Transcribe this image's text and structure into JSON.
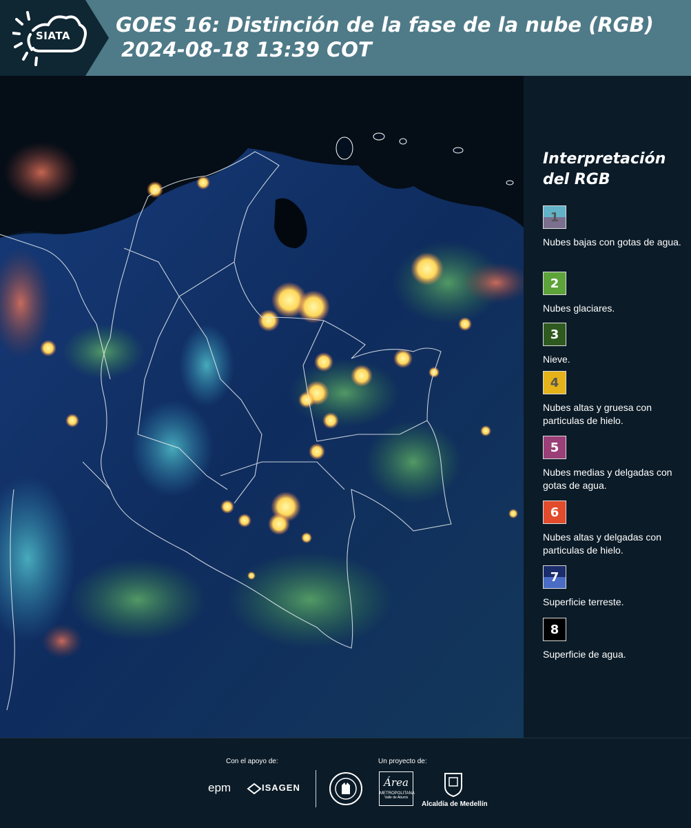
{
  "header": {
    "logo_text": "SIATA",
    "title_line1": "GOES 16: Distinción de la fase de la nube (RGB)",
    "title_line2": "2024-08-18 13:39 COT",
    "colors": {
      "band": "#4f7a88",
      "logo_band": "#0f2633"
    }
  },
  "map": {
    "icon": "satellite-rgb-map"
  },
  "legend": {
    "title": "Interpretación del RGB",
    "items": [
      {
        "number": "1",
        "label": "Nubes bajas con gotas de agua.",
        "color_top": "#62b3c7",
        "color_bottom": "#7b6f8f"
      },
      {
        "number": "2",
        "label": "Nubes glaciares.",
        "color_top": "#5ea33a",
        "color_bottom": "#5ea33a"
      },
      {
        "number": "3",
        "label": "Nieve.",
        "color_top": "#2f5a1f",
        "color_bottom": "#2f5a1f"
      },
      {
        "number": "4",
        "label": "Nubes altas y gruesa con particulas de hielo.",
        "color_top": "#e5b21a",
        "color_bottom": "#e5b21a"
      },
      {
        "number": "5",
        "label": "Nubes medias y delgadas con gotas de agua.",
        "color_top": "#9a3f77",
        "color_bottom": "#9a3f77"
      },
      {
        "number": "6",
        "label": "Nubes altas y delgadas con particulas de hielo.",
        "color_top": "#e24b2b",
        "color_bottom": "#e24b2b"
      },
      {
        "number": "7",
        "label": "Superficie terreste.",
        "color_top": "#1b2d6b",
        "color_bottom": "#4a6cc4"
      },
      {
        "number": "8",
        "label": "Superficie de agua.",
        "color_top": "#000000",
        "color_bottom": "#000000"
      }
    ]
  },
  "footer": {
    "support_label": "Con el apoyo de:",
    "project_label": "Un proyecto de:",
    "epm": "epm",
    "isagen": "ISAGEN",
    "area_script": "Área",
    "area_line1": "METROPOLITANA",
    "area_line2": "Valle de Aburrá",
    "alcaldia": "Alcaldía de Medellín"
  }
}
